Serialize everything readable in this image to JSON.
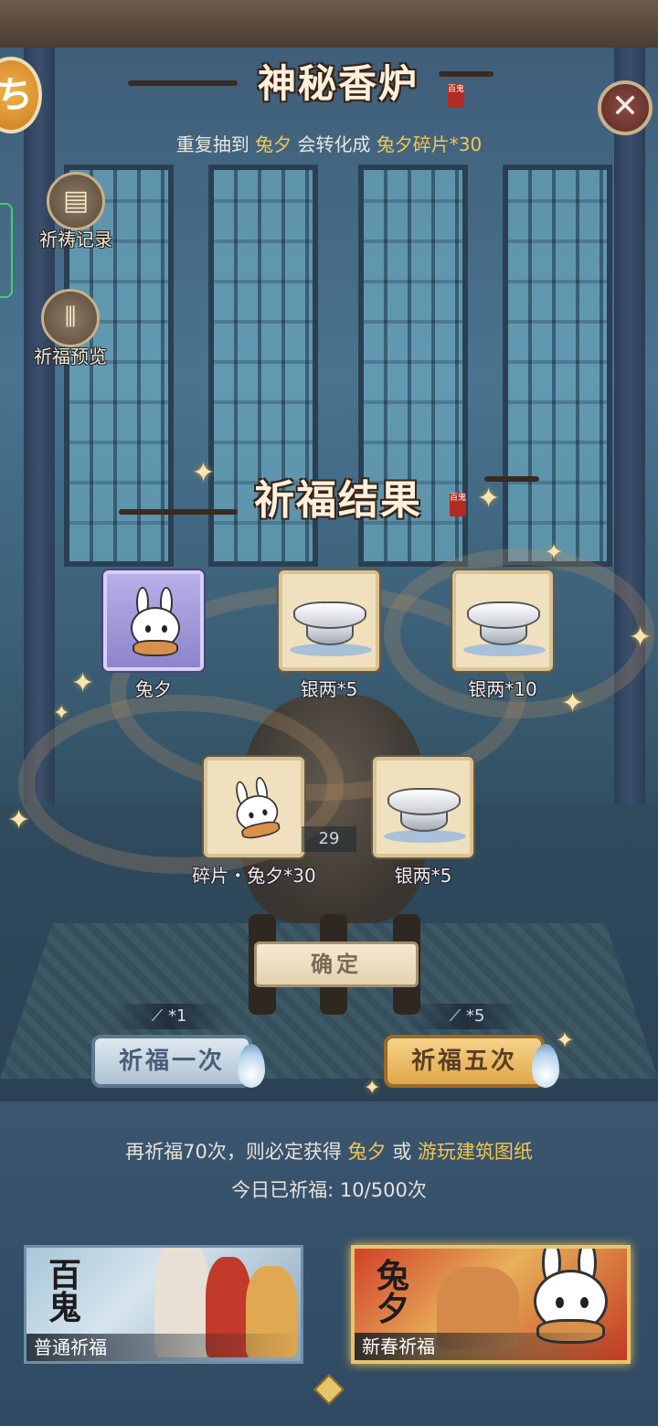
{
  "header": {
    "title": "神秘香炉",
    "seal_text": "百鬼",
    "subtitle_prefix": "重复抽到",
    "subtitle_item": "兔夕",
    "subtitle_mid": "会转化成",
    "subtitle_result": "兔夕碎片*30"
  },
  "sidebar": {
    "record_label": "祈祷记录",
    "preview_label": "祈福预览"
  },
  "result": {
    "title": "祈福结果",
    "seal_text": "百鬼",
    "items": [
      {
        "label": "兔夕",
        "icon": "bunny-character"
      },
      {
        "label": "银两*5",
        "icon": "silver-ingot-icon"
      },
      {
        "label": "银两*10",
        "icon": "silver-ingot-icon"
      },
      {
        "label": "碎片・兔夕*30",
        "icon": "bunny-fragment"
      },
      {
        "label": "银两*5",
        "icon": "silver-ingot-icon"
      }
    ],
    "background_count": "29",
    "confirm_label": "确定"
  },
  "pray": {
    "once_cost": "*1",
    "once_label": "祈福一次",
    "five_cost": "*5",
    "five_label": "祈福五次"
  },
  "info": {
    "pity_prefix": "再祈福70次，则必定获得",
    "pity_item1": "兔夕",
    "pity_or": "或",
    "pity_item2": "游玩建筑图纸",
    "today_prefix": "今日已祈福:",
    "today_count": "10",
    "today_total": "/500次"
  },
  "banners": {
    "normal_label": "普通祈福",
    "normal_glyph": "百鬼",
    "spring_label": "新春祈福",
    "spring_glyph": "兔夕"
  },
  "colors": {
    "highlight": "#f3c650",
    "title_text": "#fbf1dc"
  }
}
